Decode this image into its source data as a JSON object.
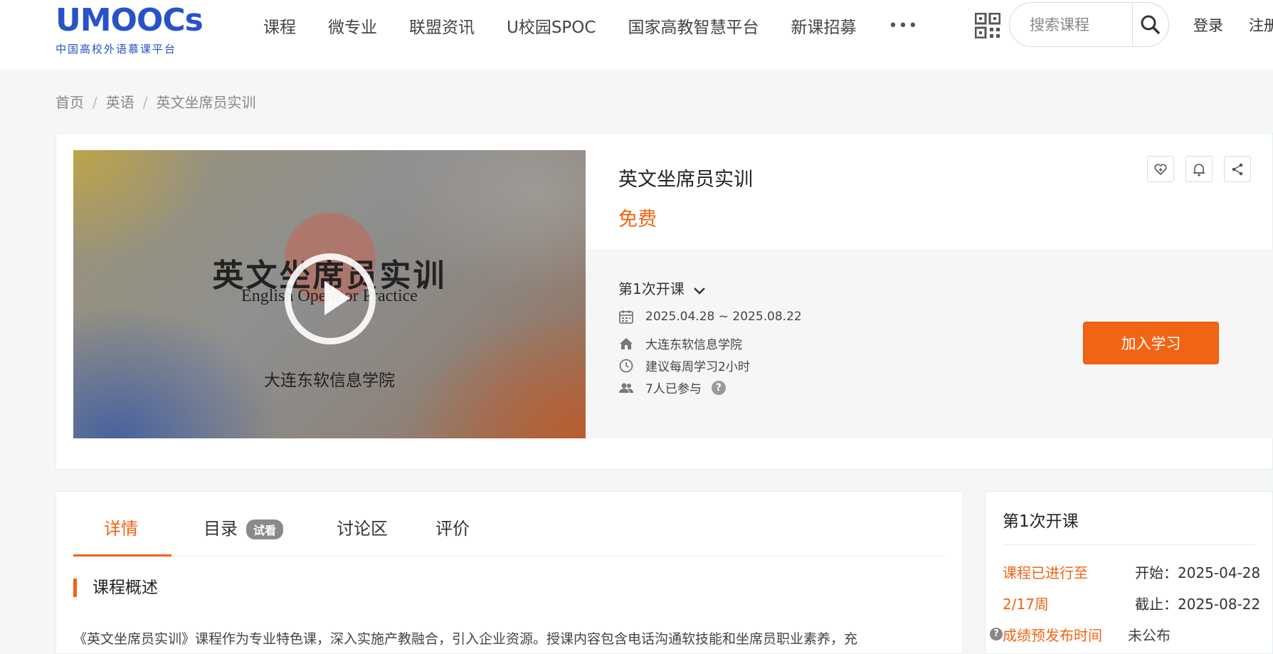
{
  "header": {
    "logo_text": "UMOOCs",
    "logo_subtitle": "中国高校外语慕课平台",
    "nav": [
      "课程",
      "微专业",
      "联盟资讯",
      "U校园SPOC",
      "国家高教智慧平台",
      "新课招募"
    ],
    "more_label": "•••",
    "search_placeholder": "搜索课程",
    "login_label": "登录",
    "register_label": "注册"
  },
  "breadcrumb": {
    "home": "首页",
    "category": "英语",
    "current": "英文坐席员实训",
    "separator": "/"
  },
  "course": {
    "title": "英文坐席员实训",
    "price": "免费",
    "cover": {
      "title": "英文坐席员实训",
      "subtitle": "English Operator Practice",
      "school": "大连东软信息学院"
    },
    "session_label": "第1次开课",
    "dates": "2025.04.28 ~ 2025.08.22",
    "school": "大连东软信息学院",
    "weekly_hours": "建议每周学习2小时",
    "participants": "7人已参与",
    "help_mark": "?",
    "join_label": "加入学习",
    "actions": [
      "like-icon",
      "bell-icon",
      "share-icon"
    ]
  },
  "tabs": {
    "items": [
      "详情",
      "目录",
      "讨论区",
      "评价"
    ],
    "trial_badge": "试看",
    "active": "详情"
  },
  "overview": {
    "section_title": "课程概述",
    "intro": "《英文坐席员实训》课程作为专业特色课，深入实施产教融合，引入企业资源。授课内容包含电话沟通软技能和坐席员职业素养，充"
  },
  "side": {
    "title": "第1次开课",
    "progress_line1": "课程已进行至",
    "progress_line2": "2/17周",
    "start": "开始：2025-04-28",
    "end": "截止：2025-08-22",
    "grade_help": "?",
    "grade_label": "成绩预发布时间",
    "grade_value": "未公布"
  },
  "colors": {
    "accent": "#f06414",
    "brand_blue": "#2752c8"
  }
}
